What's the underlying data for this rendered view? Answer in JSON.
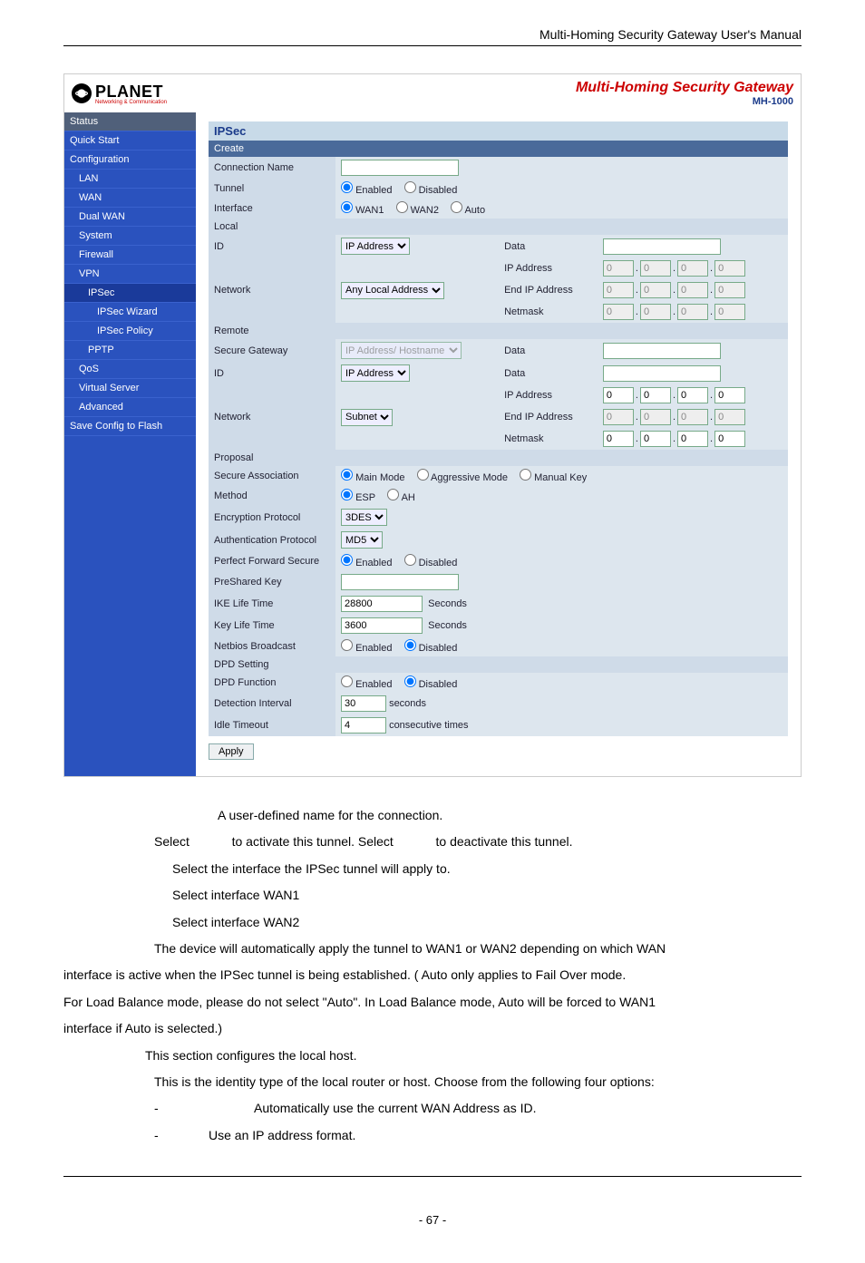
{
  "doc": {
    "header_title": "Multi-Homing  Security  Gateway  User's  Manual",
    "page_number": "- 67 -"
  },
  "header": {
    "logo_text": "PLANET",
    "logo_sub": "Networking & Communication",
    "app_title": "Multi-Homing Security Gateway",
    "app_title_sub": "MH-1000"
  },
  "sidebar": {
    "items": [
      {
        "label": "Status",
        "cls": "dark"
      },
      {
        "label": "Quick Start",
        "cls": ""
      },
      {
        "label": "Configuration",
        "cls": ""
      },
      {
        "label": "LAN",
        "cls": "lvl1"
      },
      {
        "label": "WAN",
        "cls": "lvl1"
      },
      {
        "label": "Dual WAN",
        "cls": "lvl1"
      },
      {
        "label": "System",
        "cls": "lvl1"
      },
      {
        "label": "Firewall",
        "cls": "lvl1"
      },
      {
        "label": "VPN",
        "cls": "lvl1"
      },
      {
        "label": "IPSec",
        "cls": "lvl2 sel"
      },
      {
        "label": "IPSec Wizard",
        "cls": "lvl3"
      },
      {
        "label": "IPSec Policy",
        "cls": "lvl3"
      },
      {
        "label": "PPTP",
        "cls": "lvl2"
      },
      {
        "label": "QoS",
        "cls": "lvl1"
      },
      {
        "label": "Virtual Server",
        "cls": "lvl1"
      },
      {
        "label": "Advanced",
        "cls": "lvl1"
      },
      {
        "label": "Save Config to Flash",
        "cls": ""
      }
    ]
  },
  "panel": {
    "title": "IPSec",
    "create": "Create",
    "rows": {
      "connection_name": "Connection Name",
      "tunnel": "Tunnel",
      "interface": "Interface",
      "local": "Local",
      "id": "ID",
      "network": "Network",
      "remote": "Remote",
      "secure_gateway": "Secure Gateway",
      "proposal": "Proposal",
      "secure_assoc": "Secure Association",
      "method": "Method",
      "enc_proto": "Encryption Protocol",
      "auth_proto": "Authentication Protocol",
      "pfs": "Perfect Forward Secure",
      "preshared": "PreShared Key",
      "ike_life": "IKE Life Time",
      "key_life": "Key Life Time",
      "netbios": "Netbios Broadcast",
      "dpd_setting": "DPD Setting",
      "dpd_function": "DPD Function",
      "det_interval": "Detection Interval",
      "idle_timeout": "Idle Timeout"
    },
    "labels": {
      "enabled": "Enabled",
      "disabled": "Disabled",
      "wan1": "WAN1",
      "wan2": "WAN2",
      "auto": "Auto",
      "data": "Data",
      "ip_address": "IP Address",
      "end_ip": "End IP Address",
      "netmask": "Netmask",
      "main_mode": "Main Mode",
      "aggressive": "Aggressive Mode",
      "manual_key": "Manual Key",
      "esp": "ESP",
      "ah": "AH",
      "seconds_cap": "Seconds",
      "seconds": "seconds",
      "consecutive": "consecutive times",
      "apply": "Apply"
    },
    "selects": {
      "local_id": "IP Address",
      "local_network": "Any Local Address",
      "remote_sg": "IP Address/ Hostname",
      "remote_id": "IP Address",
      "remote_network": "Subnet",
      "enc": "3DES",
      "auth": "MD5"
    },
    "values": {
      "conn_name": "",
      "local_ip": [
        "0",
        "0",
        "0",
        "0"
      ],
      "local_end": [
        "0",
        "0",
        "0",
        "0"
      ],
      "local_mask": [
        "0",
        "0",
        "0",
        "0"
      ],
      "remote_sg_data": "",
      "remote_id_data": "",
      "remote_ip": [
        "0",
        "0",
        "0",
        "0"
      ],
      "remote_end": [
        "0",
        "0",
        "0",
        "0"
      ],
      "remote_mask": [
        "0",
        "0",
        "0",
        "0"
      ],
      "preshared": "",
      "ike_life": "28800",
      "key_life": "3600",
      "det_interval": "30",
      "idle_timeout": "4"
    }
  },
  "body_text": {
    "l1a": "A user-defined name for the connection.",
    "l2a": "Select ",
    "l2b": " to activate this tunnel. Select ",
    "l2c": " to deactivate this tunnel.",
    "l3": "Select the interface the IPSec tunnel will apply to.",
    "l4": "Select interface WAN1",
    "l5": "Select interface WAN2",
    "l6": "The device will automatically apply the tunnel to WAN1 or WAN2 depending on which WAN",
    "l7": "interface is active when the IPSec tunnel is being established. (          Auto only applies to Fail Over mode.",
    "l8": "For Load Balance mode, please do not select \"Auto\". In Load Balance mode, Auto will be forced to WAN1",
    "l9": "interface if Auto is selected.)",
    "l10": " This section configures the local host.",
    "l11": "This is the identity type of the local router or host. Choose from the following four options:",
    "b1": "Automatically use the current WAN Address as ID.",
    "b2": "Use an IP address format."
  }
}
